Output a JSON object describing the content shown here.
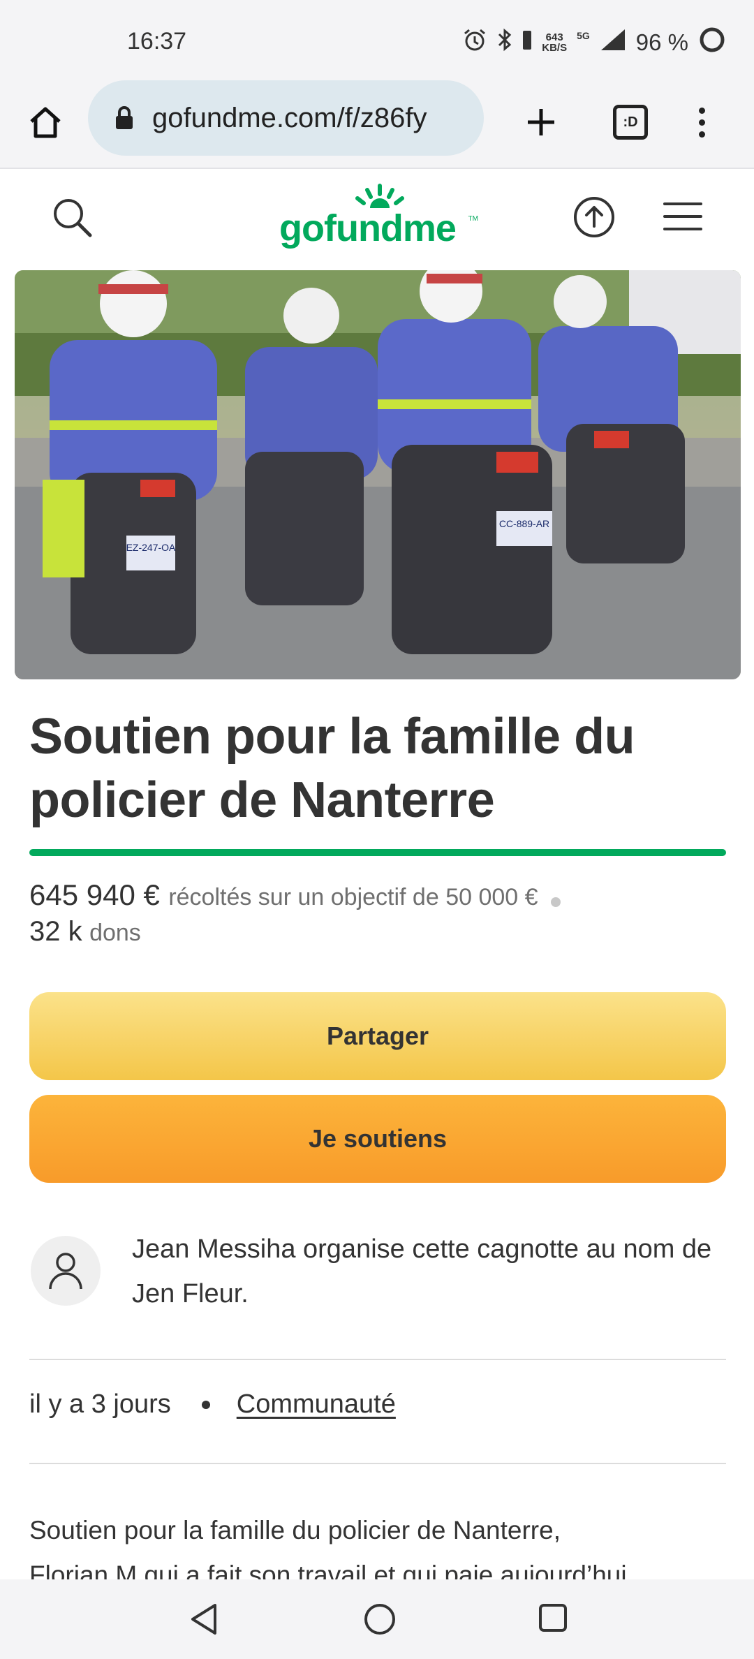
{
  "status_bar": {
    "time": "16:37",
    "speed_top": "643",
    "speed_bottom": "KB/S",
    "network": "5G",
    "battery": "96 %",
    "icons": [
      "alarm-icon",
      "bluetooth-icon",
      "signal-icon",
      "battery-icon"
    ]
  },
  "browser": {
    "url": "gofundme.com/f/z86fy",
    "tabs_label": ":D",
    "icons": [
      "home-icon",
      "lock-icon",
      "plus-icon",
      "tabs-icon",
      "more-vert-icon"
    ]
  },
  "site_header": {
    "logo_text": "gofundme",
    "logo_tm": "TM",
    "icons": [
      "search-icon",
      "share-upload-icon",
      "menu-icon"
    ]
  },
  "hero": {
    "image": "photo of police motorcycle officers",
    "plate_1": "EZ-247-OA",
    "plate_2": "CC-889-AR"
  },
  "campaign": {
    "title": "Soutien pour la famille du policier de Nanterre",
    "raised": "645 940 €",
    "goal_text": "récoltés sur un objectif de 50 000 €",
    "donations_count": "32 k",
    "donations_label": "dons",
    "progress_fraction": 1.0
  },
  "actions": {
    "share_label": "Partager",
    "donate_label": "Je soutiens"
  },
  "organizer": {
    "text": "Jean Messiha organise cette cagnotte au nom de Jen Fleur."
  },
  "meta": {
    "created": "il y a 3 jours",
    "category": "Communauté"
  },
  "story": {
    "line1": "Soutien pour la famille du policier de Nanterre,",
    "line2": "Florian M qui a fait son travail et qui paie aujourd’hui"
  },
  "colors": {
    "brand_green": "#02a95c",
    "share_button": "#f6cf5a",
    "donate_button": "#fba934"
  },
  "nav_bar": {
    "icons": [
      "back-icon",
      "home-circle-icon",
      "recents-icon"
    ]
  }
}
